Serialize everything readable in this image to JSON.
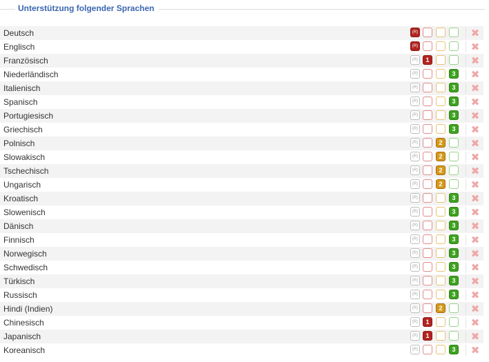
{
  "section": {
    "title": "Unterstützung folgender Sprachen"
  },
  "level_labels": {
    "native": "R",
    "one": "1",
    "two": "2",
    "three": "3"
  },
  "delete_symbol": "✖",
  "colors": {
    "title": "#3a66b0",
    "level_red": "#b2231f",
    "level_orange": "#d49a1a",
    "level_green": "#3ea21f",
    "delete": "#f0a7a7",
    "row_stripe": "#f3f3f3"
  },
  "languages": [
    {
      "name": "Deutsch",
      "level": "R"
    },
    {
      "name": "Englisch",
      "level": "R"
    },
    {
      "name": "Französisch",
      "level": "1"
    },
    {
      "name": "Niederländisch",
      "level": "3"
    },
    {
      "name": "Italienisch",
      "level": "3"
    },
    {
      "name": "Spanisch",
      "level": "3"
    },
    {
      "name": "Portugiesisch",
      "level": "3"
    },
    {
      "name": "Griechisch",
      "level": "3"
    },
    {
      "name": "Polnisch",
      "level": "2"
    },
    {
      "name": "Slowakisch",
      "level": "2"
    },
    {
      "name": "Tschechisch",
      "level": "2"
    },
    {
      "name": "Ungarisch",
      "level": "2"
    },
    {
      "name": "Kroatisch",
      "level": "3"
    },
    {
      "name": "Slowenisch",
      "level": "3"
    },
    {
      "name": "Dänisch",
      "level": "3"
    },
    {
      "name": "Finnisch",
      "level": "3"
    },
    {
      "name": "Norwegisch",
      "level": "3"
    },
    {
      "name": "Schwedisch",
      "level": "3"
    },
    {
      "name": "Türkisch",
      "level": "3"
    },
    {
      "name": "Russisch",
      "level": "3"
    },
    {
      "name": "Hindi (Indien)",
      "level": "2"
    },
    {
      "name": "Chinesisch",
      "level": "1"
    },
    {
      "name": "Japanisch",
      "level": "1"
    },
    {
      "name": "Koreanisch",
      "level": "3"
    }
  ]
}
